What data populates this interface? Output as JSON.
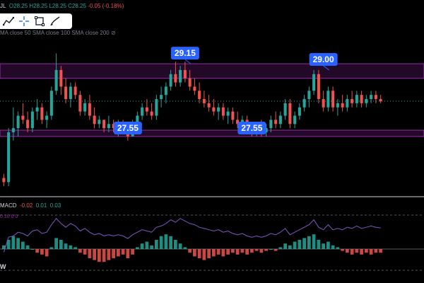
{
  "header": {
    "symbol_fragment": "JL",
    "open": "O28.25",
    "high": "H28.25",
    "low": "L28.25",
    "close": "C28.25",
    "change": "-0.05 (-0.18%)"
  },
  "sma_legend": "MA close 50 SMA close 100 SMA close 200",
  "icons": [
    "trend-line-icon",
    "crosshair-icon",
    "rectangle-icon",
    "brush-icon"
  ],
  "macd_legend": {
    "name": "MACD",
    "hist": "-0.02",
    "macd": "0.01",
    "signal": "0.03"
  },
  "macd_values_line": "0.10 0 0",
  "bottom_mark": "W",
  "colors": {
    "up": "#26a69a",
    "down": "#ef5350",
    "zone": "#9c27b0",
    "label_bg": "#2962ff",
    "line": "#7e57c2"
  },
  "chart_data": {
    "type": "candlestick",
    "ylim": [
      26.0,
      29.8
    ],
    "zones": [
      {
        "low": 28.8,
        "high": 29.15
      },
      {
        "low": 27.4,
        "high": 27.55
      }
    ],
    "price_labels": [
      {
        "text": "29.15",
        "bar": 38
      },
      {
        "text": "29.00",
        "bar": 67
      },
      {
        "text": "27.55",
        "bar": 26
      },
      {
        "text": "27.55",
        "bar": 52
      }
    ],
    "current_price": 28.25,
    "candles": [
      [
        26.4,
        26.5,
        26.2,
        26.3
      ],
      [
        26.3,
        27.6,
        26.2,
        27.5
      ],
      [
        27.5,
        28.1,
        27.3,
        27.6
      ],
      [
        27.6,
        28.0,
        27.4,
        27.9
      ],
      [
        27.9,
        28.2,
        27.7,
        27.8
      ],
      [
        27.8,
        28.0,
        27.5,
        27.6
      ],
      [
        27.6,
        28.1,
        27.5,
        28.0
      ],
      [
        28.0,
        28.3,
        27.8,
        28.1
      ],
      [
        28.1,
        28.2,
        27.7,
        27.8
      ],
      [
        27.8,
        28.0,
        27.6,
        27.9
      ],
      [
        27.9,
        28.6,
        27.8,
        28.5
      ],
      [
        28.5,
        29.4,
        28.4,
        29.0
      ],
      [
        29.0,
        29.1,
        28.4,
        28.6
      ],
      [
        28.6,
        28.8,
        28.2,
        28.3
      ],
      [
        28.3,
        28.7,
        28.1,
        28.6
      ],
      [
        28.6,
        28.7,
        28.3,
        28.4
      ],
      [
        28.4,
        28.5,
        27.9,
        28.0
      ],
      [
        28.0,
        28.3,
        27.9,
        28.2
      ],
      [
        28.2,
        28.4,
        27.8,
        27.9
      ],
      [
        27.9,
        28.1,
        27.6,
        27.7
      ],
      [
        27.7,
        27.9,
        27.6,
        27.8
      ],
      [
        27.8,
        27.8,
        27.5,
        27.6
      ],
      [
        27.6,
        27.9,
        27.5,
        27.7
      ],
      [
        27.7,
        27.8,
        27.5,
        27.6
      ],
      [
        27.6,
        27.8,
        27.4,
        27.7
      ],
      [
        27.7,
        27.8,
        27.5,
        27.6
      ],
      [
        27.6,
        27.7,
        27.3,
        27.4
      ],
      [
        27.4,
        27.8,
        27.4,
        27.7
      ],
      [
        27.7,
        28.0,
        27.6,
        27.9
      ],
      [
        27.9,
        28.2,
        27.8,
        28.1
      ],
      [
        28.1,
        28.3,
        27.9,
        28.0
      ],
      [
        28.0,
        28.2,
        27.8,
        27.9
      ],
      [
        27.9,
        28.4,
        27.8,
        28.3
      ],
      [
        28.3,
        28.6,
        28.1,
        28.4
      ],
      [
        28.4,
        28.7,
        28.2,
        28.6
      ],
      [
        28.6,
        29.0,
        28.5,
        28.9
      ],
      [
        28.9,
        29.2,
        28.6,
        28.7
      ],
      [
        28.7,
        29.1,
        28.6,
        29.0
      ],
      [
        29.0,
        29.2,
        28.7,
        28.8
      ],
      [
        28.8,
        29.0,
        28.5,
        28.6
      ],
      [
        28.6,
        28.8,
        28.4,
        28.5
      ],
      [
        28.5,
        28.7,
        28.2,
        28.3
      ],
      [
        28.3,
        28.5,
        28.1,
        28.2
      ],
      [
        28.2,
        28.4,
        28.0,
        28.1
      ],
      [
        28.1,
        28.3,
        27.9,
        28.0
      ],
      [
        28.0,
        28.2,
        27.8,
        28.1
      ],
      [
        28.1,
        28.2,
        27.8,
        27.9
      ],
      [
        27.9,
        28.1,
        27.7,
        28.0
      ],
      [
        28.0,
        28.1,
        27.7,
        27.8
      ],
      [
        27.8,
        28.0,
        27.6,
        27.7
      ],
      [
        27.7,
        27.9,
        27.5,
        27.8
      ],
      [
        27.8,
        27.9,
        27.5,
        27.6
      ],
      [
        27.6,
        27.7,
        27.4,
        27.5
      ],
      [
        27.5,
        27.7,
        27.4,
        27.6
      ],
      [
        27.6,
        27.8,
        27.4,
        27.5
      ],
      [
        27.5,
        27.7,
        27.4,
        27.6
      ],
      [
        27.6,
        27.9,
        27.5,
        27.8
      ],
      [
        27.8,
        28.0,
        27.6,
        27.7
      ],
      [
        27.7,
        28.0,
        27.6,
        27.9
      ],
      [
        27.9,
        28.3,
        27.8,
        28.2
      ],
      [
        28.2,
        28.3,
        27.6,
        27.7
      ],
      [
        27.7,
        28.0,
        27.6,
        27.9
      ],
      [
        27.9,
        28.2,
        27.8,
        28.1
      ],
      [
        28.1,
        28.4,
        28.0,
        28.3
      ],
      [
        28.3,
        28.6,
        28.1,
        28.5
      ],
      [
        28.5,
        29.0,
        28.4,
        28.9
      ],
      [
        28.9,
        29.0,
        28.2,
        28.3
      ],
      [
        28.3,
        28.5,
        28.0,
        28.1
      ],
      [
        28.1,
        28.6,
        28.0,
        28.5
      ],
      [
        28.5,
        28.6,
        28.0,
        28.1
      ],
      [
        28.1,
        28.3,
        27.9,
        28.2
      ],
      [
        28.2,
        28.4,
        28.0,
        28.1
      ],
      [
        28.1,
        28.4,
        28.0,
        28.3
      ],
      [
        28.3,
        28.5,
        28.1,
        28.2
      ],
      [
        28.2,
        28.5,
        28.1,
        28.4
      ],
      [
        28.4,
        28.5,
        28.1,
        28.2
      ],
      [
        28.2,
        28.4,
        28.1,
        28.3
      ],
      [
        28.3,
        28.5,
        28.2,
        28.4
      ],
      [
        28.4,
        28.5,
        28.2,
        28.3
      ],
      [
        28.3,
        28.4,
        28.2,
        28.25
      ]
    ],
    "macd_hist": [
      0.02,
      0.05,
      0.07,
      0.06,
      0.04,
      0.02,
      0.0,
      -0.02,
      -0.03,
      -0.04,
      0.01,
      0.06,
      0.05,
      0.03,
      0.02,
      0.01,
      -0.02,
      -0.03,
      -0.05,
      -0.06,
      -0.07,
      -0.07,
      -0.06,
      -0.05,
      -0.04,
      -0.03,
      -0.05,
      -0.03,
      0.01,
      0.03,
      0.04,
      0.02,
      0.05,
      0.07,
      0.08,
      0.07,
      0.05,
      0.03,
      0.01,
      -0.02,
      -0.04,
      -0.05,
      -0.06,
      -0.05,
      -0.04,
      -0.03,
      -0.04,
      -0.03,
      -0.02,
      -0.03,
      -0.02,
      -0.03,
      -0.02,
      -0.01,
      -0.02,
      -0.01,
      0.0,
      -0.01,
      0.01,
      0.03,
      0.02,
      0.04,
      0.05,
      0.06,
      0.07,
      0.08,
      0.05,
      0.03,
      0.04,
      0.02,
      0.01,
      -0.01,
      -0.02,
      -0.03,
      -0.02,
      -0.03,
      -0.02,
      -0.03,
      -0.02,
      -0.02
    ]
  }
}
